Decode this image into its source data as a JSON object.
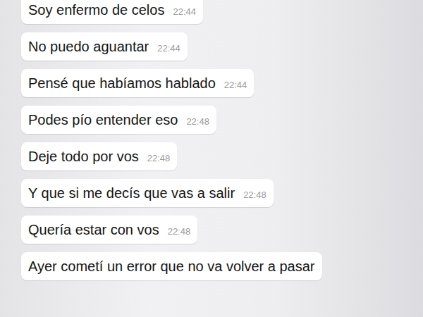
{
  "messages": [
    {
      "text": "Soy enfermo de celos",
      "time": "22:44"
    },
    {
      "text": "No puedo aguantar",
      "time": "22:44"
    },
    {
      "text": "Pensé que habíamos hablado",
      "time": "22:44"
    },
    {
      "text": "Podes pío entender eso",
      "time": "22:48"
    },
    {
      "text": "Deje todo por vos",
      "time": "22:48"
    },
    {
      "text": "Y que si me decís que vas a salir",
      "time": "22:48"
    },
    {
      "text": "Quería estar con vos",
      "time": "22:48"
    },
    {
      "text": "Ayer cometí un error que no va volver a pasar",
      "time": ""
    }
  ]
}
